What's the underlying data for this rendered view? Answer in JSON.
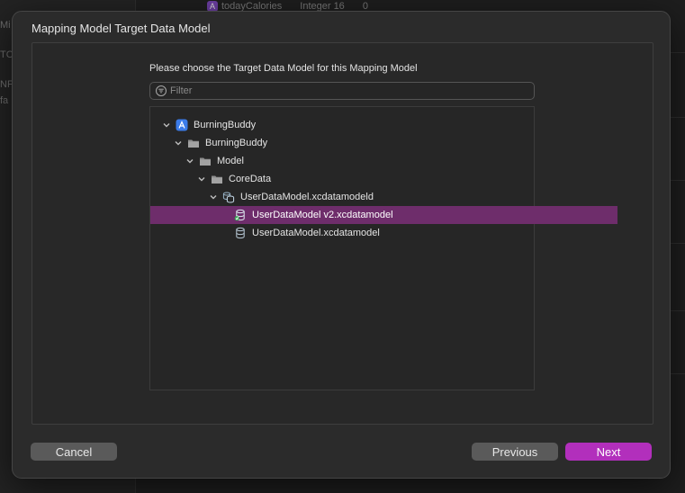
{
  "dialog": {
    "title": "Mapping Model Target Data Model",
    "prompt": "Please choose the Target Data Model for this Mapping Model",
    "filter": {
      "placeholder": "Filter",
      "value": ""
    },
    "tree": [
      {
        "label": "BurningBuddy",
        "icon": "app-project-icon",
        "level": 0,
        "expanded": true
      },
      {
        "label": "BurningBuddy",
        "icon": "folder-icon",
        "level": 1,
        "expanded": true
      },
      {
        "label": "Model",
        "icon": "folder-icon",
        "level": 2,
        "expanded": true
      },
      {
        "label": "CoreData",
        "icon": "folder-icon",
        "level": 3,
        "expanded": true
      },
      {
        "label": "UserDataModel.xcdatamodeld",
        "icon": "data-model-bundle-icon",
        "level": 4,
        "expanded": true
      },
      {
        "label": "UserDataModel v2.xcdatamodel",
        "icon": "data-model-current-icon",
        "level": 5,
        "selected": true
      },
      {
        "label": "UserDataModel.xcdatamodel",
        "icon": "data-model-icon",
        "level": 5
      }
    ],
    "buttons": {
      "cancel": "Cancel",
      "previous": "Previous",
      "next": "Next"
    }
  },
  "background": {
    "top_row": {
      "name": "todayCalories",
      "type": "Integer 16",
      "value": "0"
    },
    "sidebar_fragments": [
      "Mi",
      "TC",
      "NF",
      "fa"
    ]
  },
  "colors": {
    "selection": "#6e2d6b",
    "primary_button": "#b22fbc",
    "secondary_button": "#5a5a5a"
  }
}
